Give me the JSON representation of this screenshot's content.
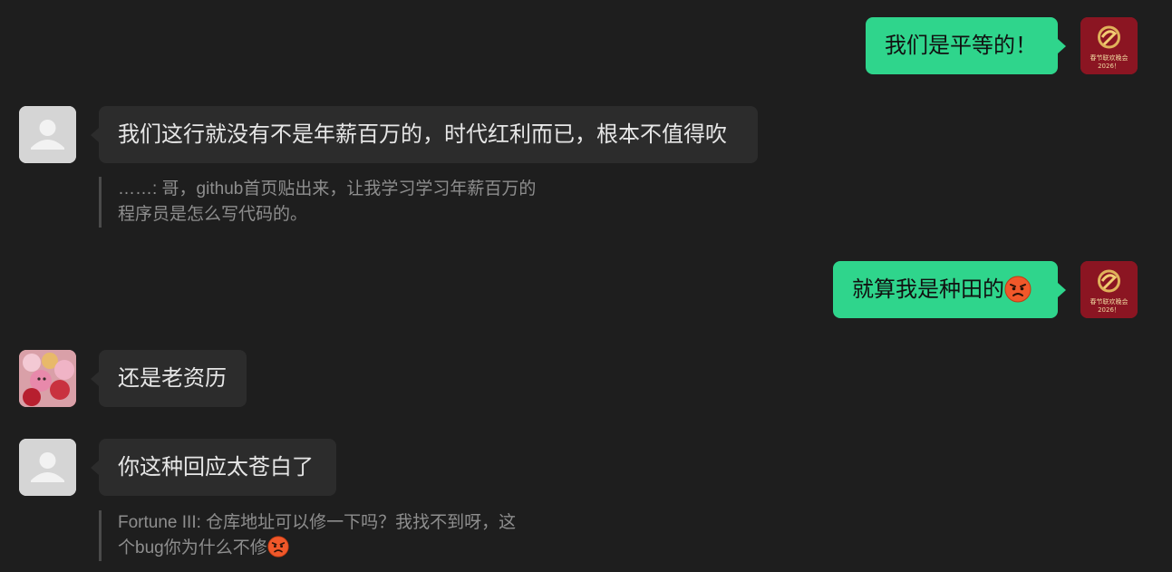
{
  "messages": [
    {
      "text": "我们是平等的！",
      "side": "outgoing"
    },
    {
      "text": "我们这行就没有不是年薪百万的，时代红利而已，根本不值得吹",
      "side": "incoming",
      "quote": {
        "line1": "……: 哥，github首页贴出来，让我学习学习年薪百万的",
        "line2": "程序员是怎么写代码的。"
      }
    },
    {
      "text": "就算我是种田的",
      "side": "outgoing",
      "emoji": "angry-face-icon"
    },
    {
      "text": "还是老资历",
      "side": "incoming"
    },
    {
      "text": "你这种回应太苍白了",
      "side": "incoming",
      "quote": {
        "line1": "Fortune III: 仓库地址可以修一下吗？我找不到呀，这",
        "line2": "个bug你为什么不修",
        "emoji": "angry-face-icon"
      }
    }
  ],
  "avatar_brand": {
    "line1": "春节联欢晚会",
    "line2": "2026！"
  },
  "colors": {
    "background": "#1e1e1e",
    "incoming_bubble": "#2c2c2c",
    "outgoing_bubble": "#2fd58c",
    "quote_text": "#8e8e8e"
  }
}
